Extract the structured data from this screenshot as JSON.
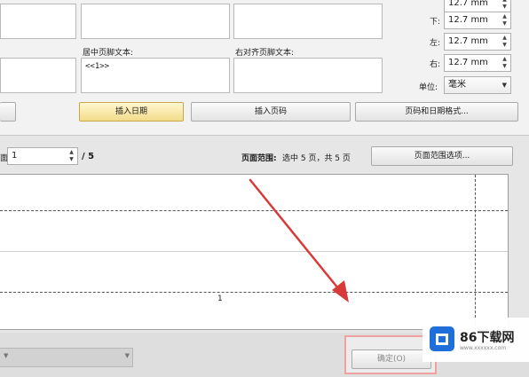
{
  "header_footer": {
    "center_footer_label": "居中页脚文本:",
    "center_footer_value": "<<1>>",
    "right_footer_label": "右对齐页脚文本:"
  },
  "margins": {
    "top_value": "12.7 mm",
    "bottom_label": "下:",
    "bottom_value": "12.7 mm",
    "left_label": "左:",
    "left_value": "12.7 mm",
    "right_label": "右:",
    "right_value": "12.7 mm",
    "unit_label": "单位:",
    "unit_value": "毫米"
  },
  "buttons": {
    "insert_date": "插入日期",
    "insert_page_number": "插入页码",
    "page_date_format": "页码和日期格式..."
  },
  "page_nav": {
    "current_page": "1",
    "total": "/ 5",
    "range_label": "页面范围:",
    "range_value": "选中 5 页，共 5 页",
    "range_options_button": "页面范围选项..."
  },
  "preview": {
    "page_number": "1"
  },
  "dialog": {
    "ok_button": "确定(O)"
  },
  "watermark": {
    "brand": "86下载网",
    "url": "www.xxxxxx.com"
  },
  "colors": {
    "arrow": "#d83a3a",
    "highlight_button": "#f2dc8a",
    "logo_blue": "#1e6fd9"
  }
}
